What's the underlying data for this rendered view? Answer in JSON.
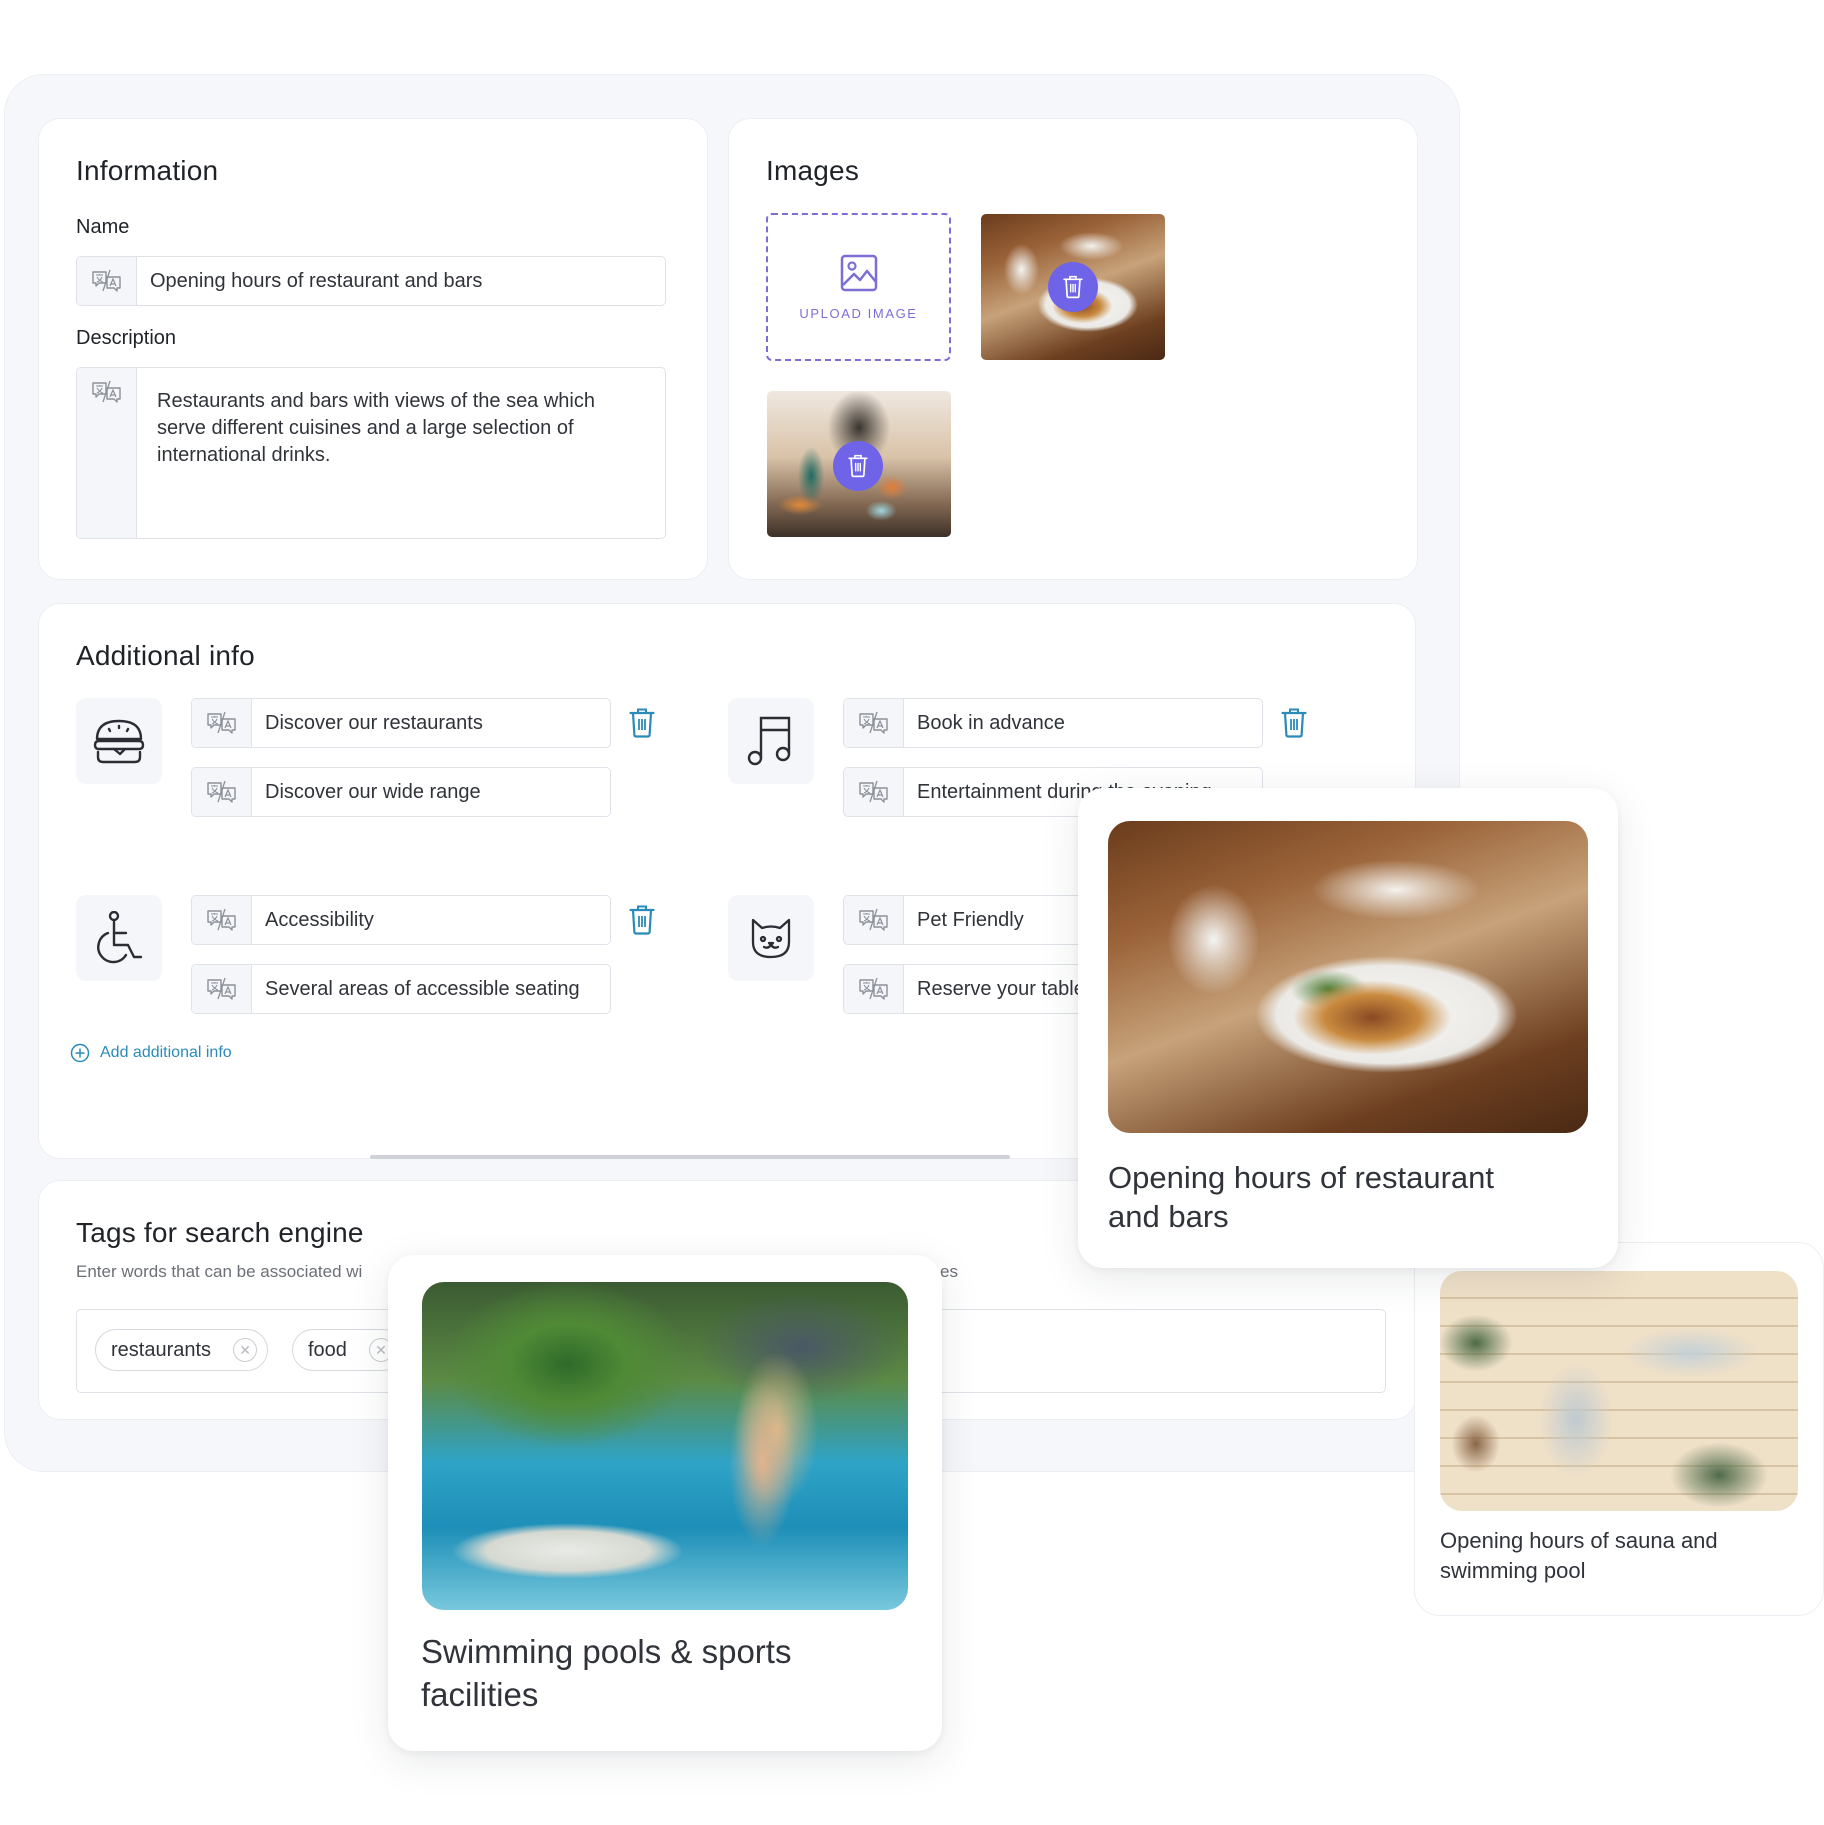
{
  "information": {
    "title": "Information",
    "name_label": "Name",
    "name_value": "Opening hours of restaurant and bars",
    "description_label": "Description",
    "description_value": "Restaurants and bars with views of the sea which serve different cuisines and a large selection of international drinks."
  },
  "images": {
    "title": "Images",
    "upload_label": "UPLOAD IMAGE",
    "items": [
      {
        "alt": "restaurant dinner plate photo"
      },
      {
        "alt": "cocktail bar photo"
      }
    ]
  },
  "additional_info": {
    "title": "Additional info",
    "add_label": "Add additional info",
    "items": [
      {
        "icon": "burger-icon",
        "title": "Discover our restaurants",
        "subtitle": "Discover our wide range"
      },
      {
        "icon": "music-note-icon",
        "title": "Book in advance",
        "subtitle": "Entertainment during the evening"
      },
      {
        "icon": "wheelchair-icon",
        "title": "Accessibility",
        "subtitle": "Several areas of accessible seating"
      },
      {
        "icon": "cat-icon",
        "title": "Pet Friendly",
        "subtitle": "Reserve your table"
      }
    ]
  },
  "tags": {
    "title": "Tags for search engine",
    "hint_left": "Enter words that can be associated wi",
    "hint_right": "es",
    "items": [
      "restaurants",
      "food"
    ]
  },
  "preview_cards": [
    {
      "title": "Opening hours of restaurant and bars",
      "image": "restaurant dinner plate"
    },
    {
      "title": "Swimming pools & sports facilities",
      "image": "woman with floating breakfast in pool"
    },
    {
      "title": "Opening hours of sauna and swimming pool",
      "image": "two women relaxing in sauna"
    }
  ],
  "colors": {
    "accent_purple": "#6f63e8",
    "upload_dashed": "#7b6fd6",
    "link_blue": "#2b8bb8",
    "trash_blue": "#2b8bb8"
  }
}
